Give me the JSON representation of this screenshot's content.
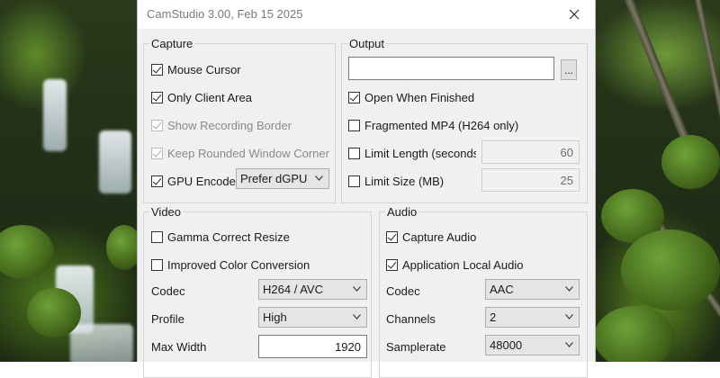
{
  "window": {
    "title": "CamStudio 3.00, Feb 15 2025"
  },
  "icons": {
    "close": "close-icon",
    "dropdown": "chevron-down-icon"
  },
  "capture": {
    "legend": "Capture",
    "mouse_cursor": {
      "label": "Mouse Cursor",
      "checked": true,
      "disabled": false
    },
    "only_client_area": {
      "label": "Only Client Area",
      "checked": true,
      "disabled": false
    },
    "show_recording_border": {
      "label": "Show Recording Border",
      "checked": true,
      "disabled": true
    },
    "keep_rounded_corner": {
      "label": "Keep Rounded Window Corner",
      "checked": true,
      "disabled": true
    },
    "gpu_encode": {
      "label": "GPU Encode",
      "checked": true,
      "disabled": false
    },
    "gpu_select": "Prefer dGPU"
  },
  "output": {
    "legend": "Output",
    "path_value": "",
    "browse_label": "...",
    "open_when_finished": {
      "label": "Open When Finished",
      "checked": true
    },
    "fragmented_mp4": {
      "label": "Fragmented MP4 (H264 only)",
      "checked": false
    },
    "limit_length": {
      "label": "Limit Length (seconds)",
      "checked": false,
      "value": "60"
    },
    "limit_size": {
      "label": "Limit Size (MB)",
      "checked": false,
      "value": "25"
    }
  },
  "video": {
    "legend": "Video",
    "gamma": {
      "label": "Gamma Correct Resize",
      "checked": false
    },
    "improved_color": {
      "label": "Improved Color Conversion",
      "checked": false
    },
    "codec_label": "Codec",
    "codec_value": "H264 / AVC",
    "profile_label": "Profile",
    "profile_value": "High",
    "max_width_label": "Max Width",
    "max_width_value": "1920"
  },
  "audio": {
    "legend": "Audio",
    "capture_audio": {
      "label": "Capture Audio",
      "checked": true
    },
    "app_local_audio": {
      "label": "Application Local Audio",
      "checked": true
    },
    "codec_label": "Codec",
    "codec_value": "AAC",
    "channels_label": "Channels",
    "channels_value": "2",
    "samplerate_label": "Samplerate",
    "samplerate_value": "48000"
  }
}
